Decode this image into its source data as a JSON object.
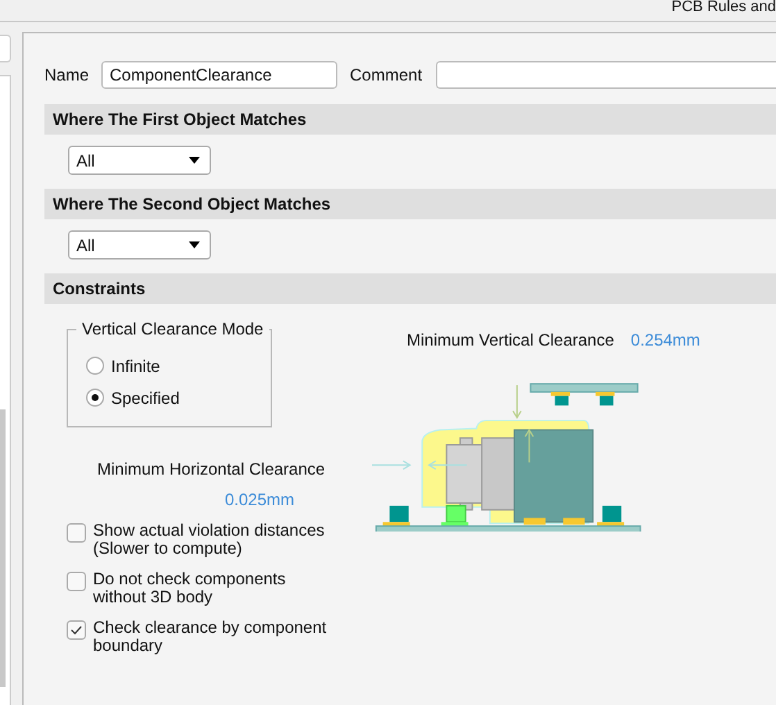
{
  "window": {
    "title": "PCB Rules and"
  },
  "rule": {
    "name_label": "Name",
    "name": "ComponentClearance",
    "comment_label": "Comment"
  },
  "sections": [
    {
      "title": "Where The First Object Matches",
      "dropdown": "All"
    },
    {
      "title": "Where The Second Object Matches",
      "dropdown": "All"
    }
  ],
  "constraints": {
    "title": "Constraints",
    "mode_group": {
      "title": "Vertical Clearance Mode",
      "options": [
        {
          "label": "Infinite",
          "selected": false
        },
        {
          "label": "Specified",
          "selected": true
        }
      ]
    },
    "vertical_label": "Minimum Vertical Clearance",
    "vertical_value": "0.254mm",
    "horizontal_label": "Minimum Horizontal Clearance",
    "horizontal_value": "0.025mm",
    "options": [
      {
        "label": "Show actual violation distances (Slower to compute)",
        "checked": false
      },
      {
        "label": "Do not check components without 3D body",
        "checked": false
      },
      {
        "label": "Check clearance by component boundary",
        "checked": true
      }
    ]
  }
}
